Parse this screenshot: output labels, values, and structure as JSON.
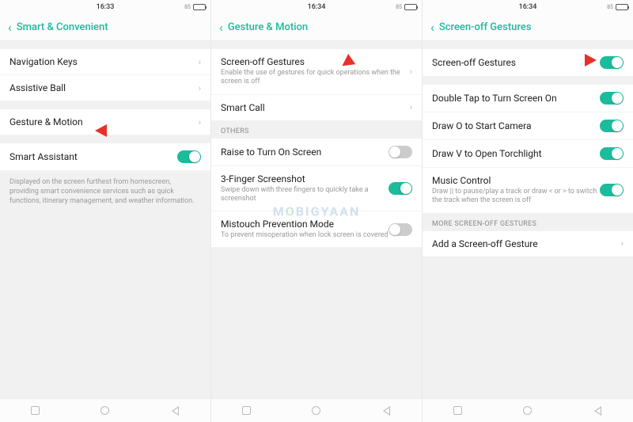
{
  "watermark": "MOBIGYAAN",
  "screen1": {
    "time": "16:33",
    "battery": "85",
    "title": "Smart & Convenient",
    "rows": {
      "nav_keys": "Navigation Keys",
      "assistive": "Assistive Ball",
      "gesture": "Gesture & Motion",
      "smart_label": "Smart Assistant"
    },
    "info": "Displayed on the screen furthest from homescreen, providing smart convenience services such as quick functions, itinerary management, and weather information."
  },
  "screen2": {
    "time": "16:34",
    "battery": "85",
    "title": "Gesture & Motion",
    "rows": {
      "sog_title": "Screen-off Gestures",
      "sog_sub": "Enable the use of gestures for quick operations when the screen is off",
      "smartcall": "Smart Call",
      "section_others": "OTHERS",
      "raise": "Raise to Turn On Screen",
      "tfs_title": "3-Finger Screenshot",
      "tfs_sub": "Swipe down with three fingers to quickly take a screenshot",
      "mis_title": "Mistouch Prevention Mode",
      "mis_sub": "To prevent misoperation when lock screen is covered"
    }
  },
  "screen3": {
    "time": "16:34",
    "battery": "85",
    "title": "Screen-off Gestures",
    "rows": {
      "sog": "Screen-off Gestures",
      "dtap": "Double Tap to Turn Screen On",
      "drawo": "Draw O to Start Camera",
      "drawv": "Draw V to Open Torchlight",
      "music_title": "Music Control",
      "music_sub": "Draw || to pause/play a track or draw < or > to switch the track when the screen is off",
      "section_more": "MORE SCREEN-OFF GESTURES",
      "add": "Add a Screen-off Gesture"
    }
  }
}
